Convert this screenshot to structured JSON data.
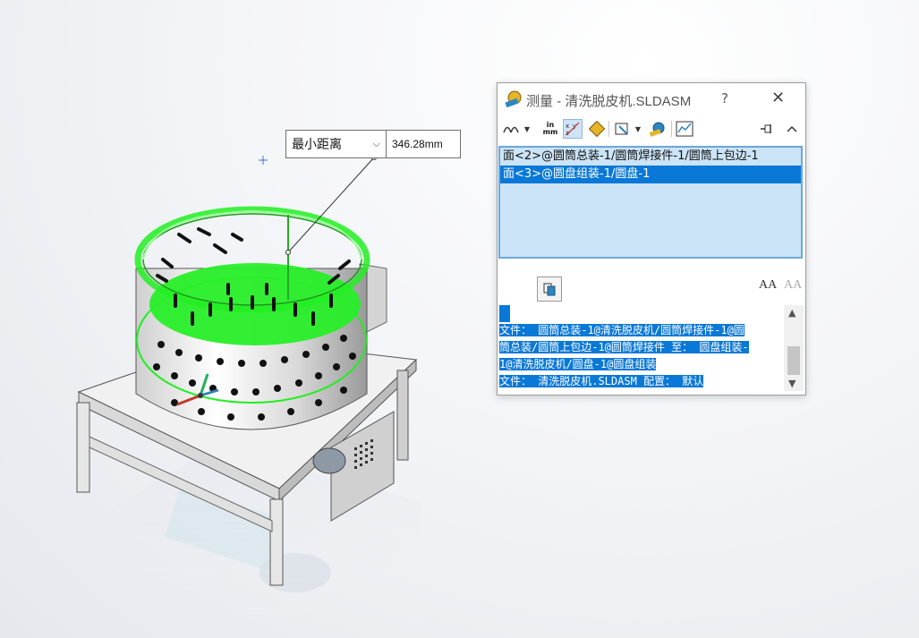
{
  "viewport": {
    "triad": {
      "x_color": "#c0392b",
      "y_color": "#27ae60",
      "z_color": "#2e86c1"
    }
  },
  "callout": {
    "option_label": "最小距离",
    "value": "346.28mm",
    "dropdown_icon": "chevron-down-icon"
  },
  "dialog": {
    "title": "测量 - 清洗脱皮机.SLDASM",
    "help_label": "?",
    "close_label": "✕",
    "toolbar": {
      "items": [
        "arc-center-options",
        "units-precision",
        "show-xyz-measurements",
        "point-to-point",
        "projection-on",
        "measurement-history",
        "create-sensor",
        "pin",
        "collapse"
      ],
      "units_line1": "in",
      "units_line2": "mm"
    },
    "selections": [
      "面<2>@圆筒总装-1/圆筒焊接件-1/圆筒上包边-1",
      "面<3>@圆盘组装-1/圆盘-1"
    ],
    "results_lines": [
      "文件： 圆筒总装-1@清洗脱皮机/圆筒焊接件-1@圆",
      "筒总装/圆筒上包边-1@圆筒焊接件 至： 圆盘组装-",
      "1@清洗脱皮机/圆盘-1@圆盘组装",
      "文件： 清洗脱皮机.SLDASM 配置： 默认"
    ],
    "scroll_up": "▲",
    "scroll_down": "▼"
  },
  "colors": {
    "highlight": "#0a78d7",
    "selection_bg": "#cce4f7",
    "selected_geometry": "#22ee22"
  }
}
